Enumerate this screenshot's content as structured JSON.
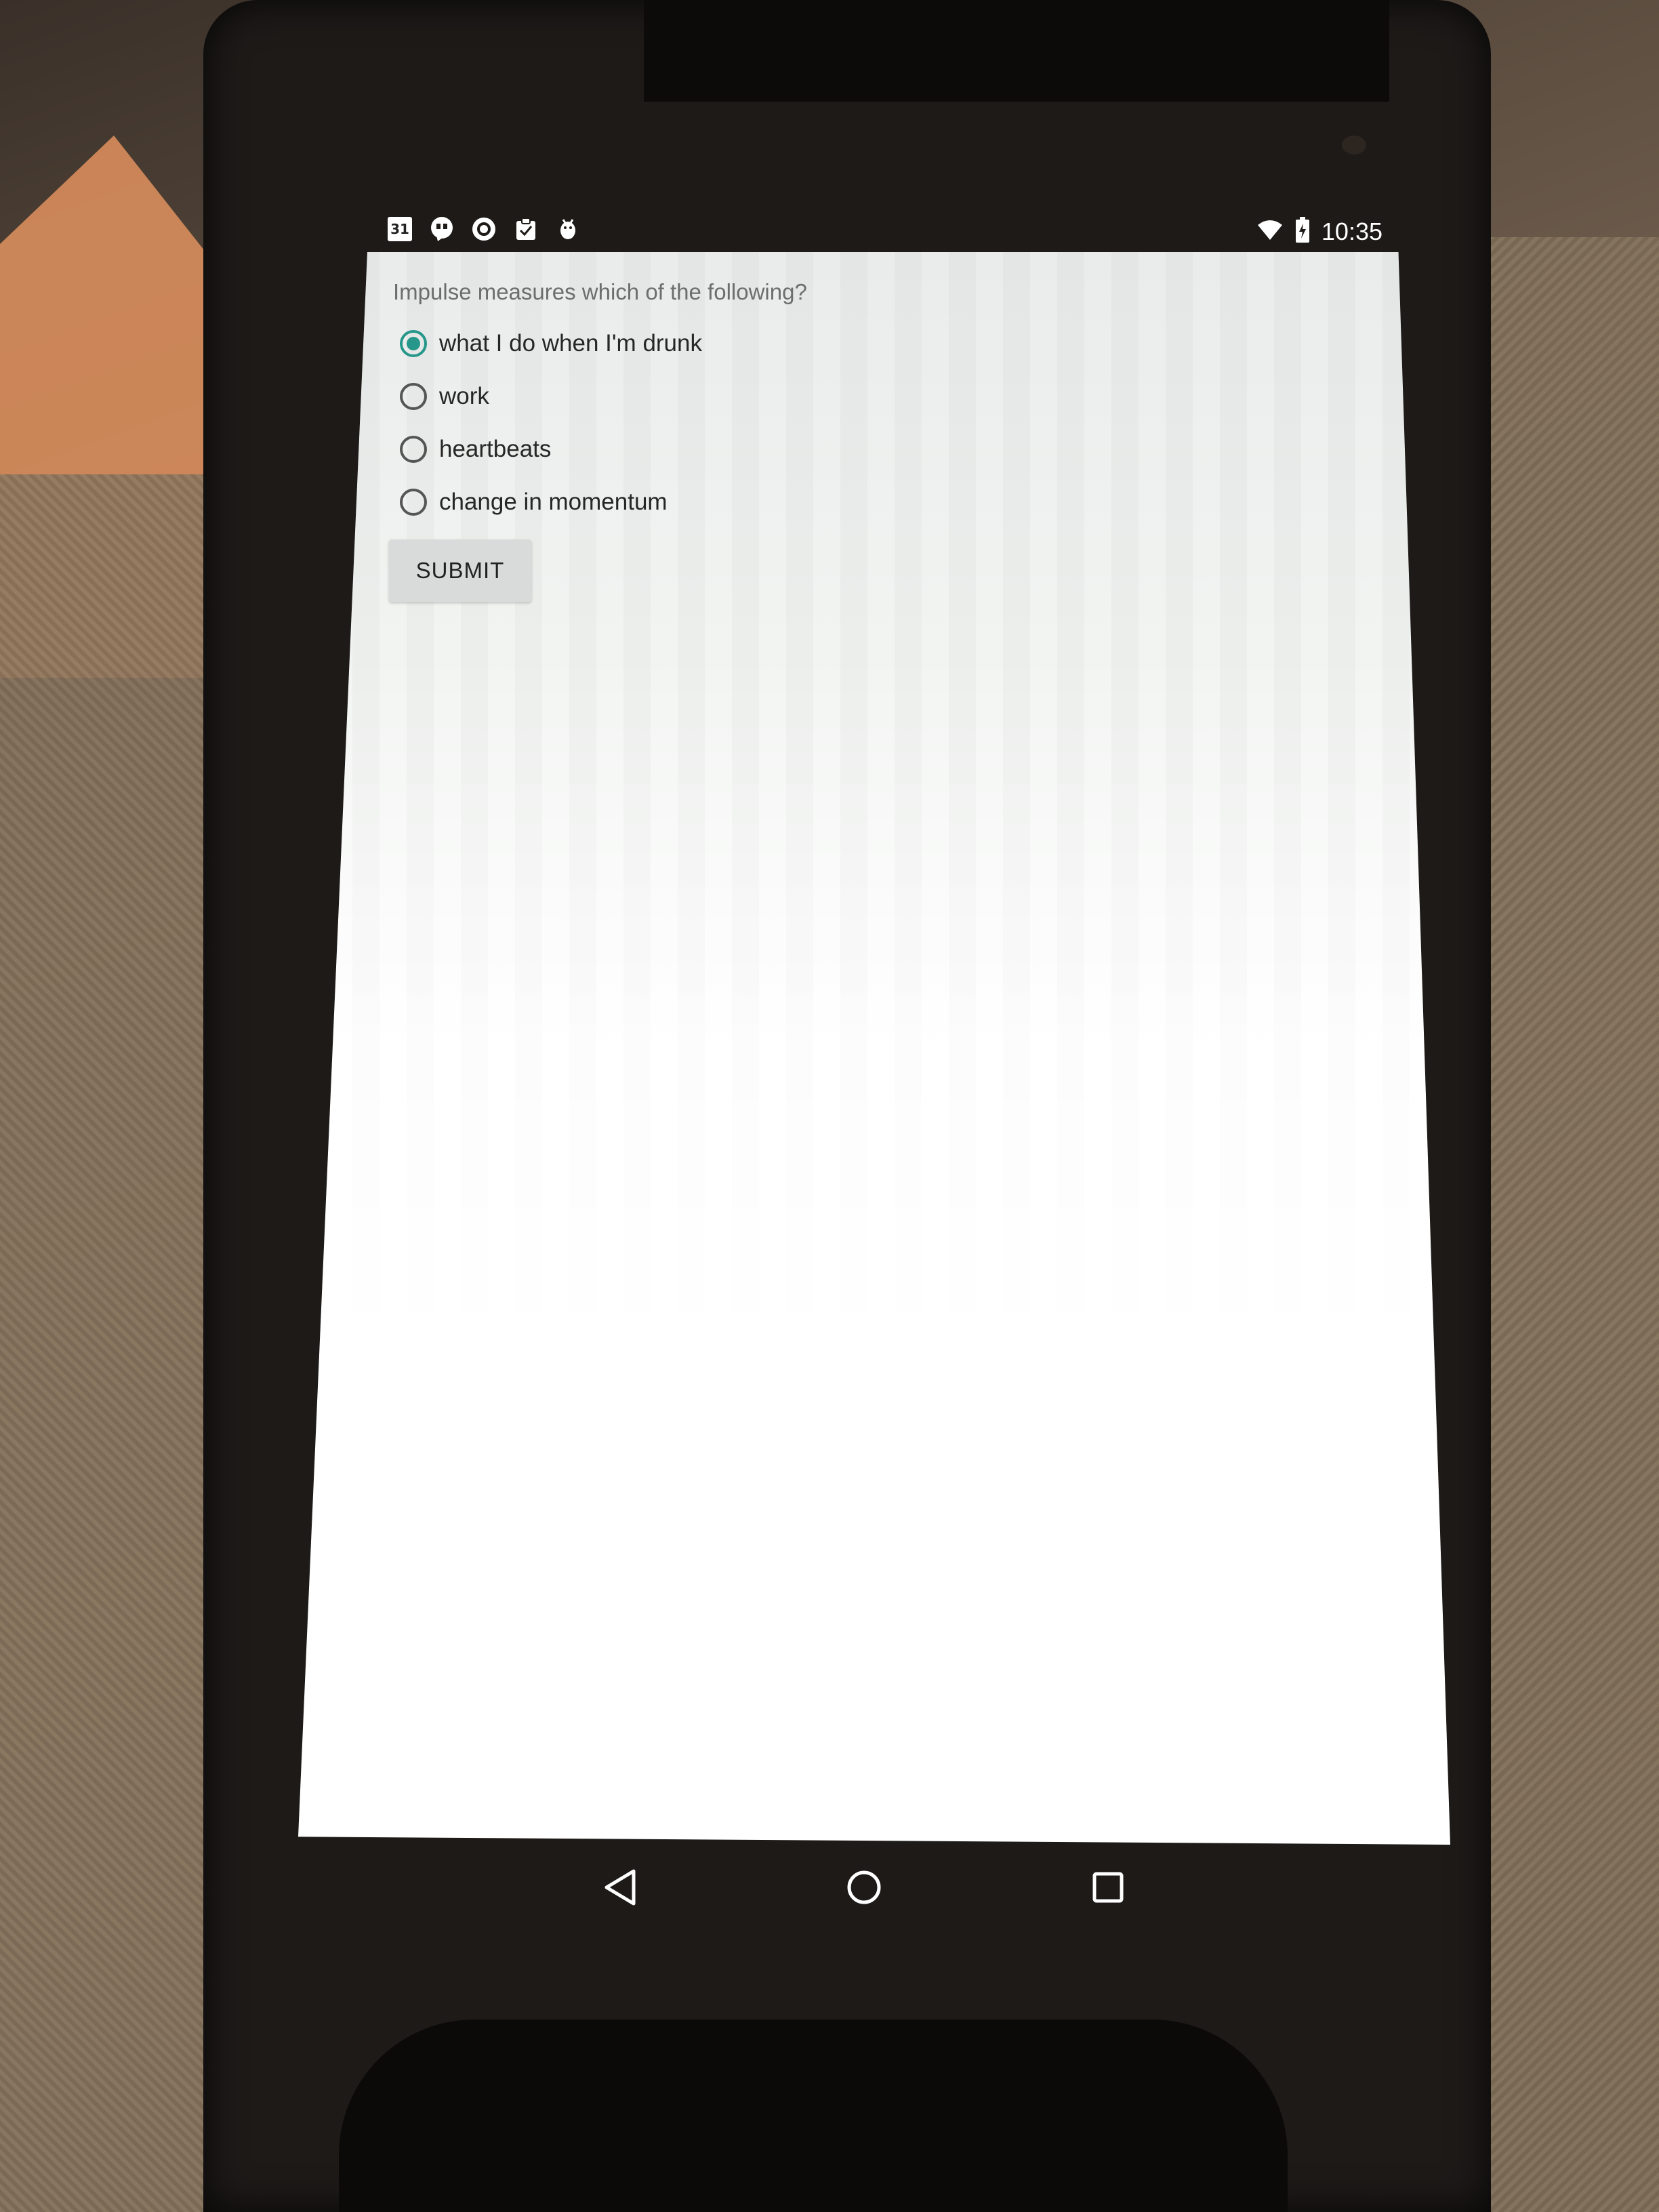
{
  "status_bar": {
    "left_icons": [
      {
        "icon": "calendar-icon",
        "text": "31"
      },
      {
        "icon": "hangouts-icon"
      },
      {
        "icon": "circle-notification-icon"
      },
      {
        "icon": "clipboard-check-icon"
      },
      {
        "icon": "android-debug-icon"
      }
    ],
    "time": "10:35",
    "right_icons": [
      "wifi-icon",
      "battery-charging-icon"
    ]
  },
  "quiz": {
    "question": "Impulse measures which of the following?",
    "options": [
      {
        "label": "what I do when I'm drunk",
        "selected": true
      },
      {
        "label": "work",
        "selected": false
      },
      {
        "label": "heartbeats",
        "selected": false
      },
      {
        "label": "change in momentum",
        "selected": false
      }
    ],
    "submit_label": "SUBMIT"
  },
  "nav_bar": {
    "buttons": [
      "back-icon",
      "home-icon",
      "recents-icon"
    ]
  },
  "colors": {
    "accent": "#26978a",
    "button_bg": "#d9dbda",
    "question_text": "#6d6d6d"
  }
}
